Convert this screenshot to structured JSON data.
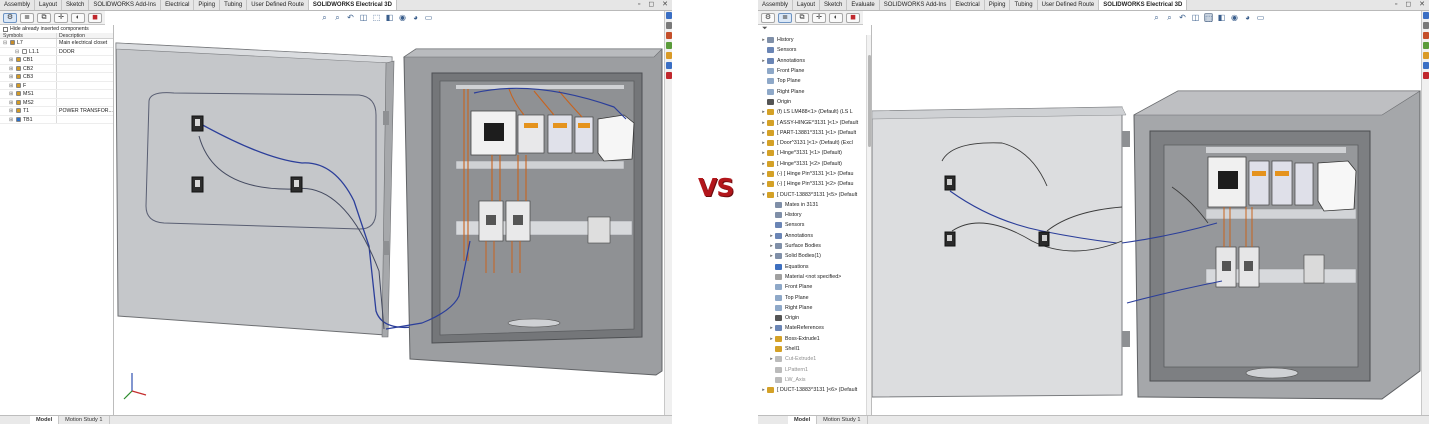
{
  "comparison": {
    "separator_label": "VS"
  },
  "colors": {
    "vs_red": "#b2161b",
    "enclosure_grey": "#9a9a9a",
    "wire_blue": "#2b3e9a",
    "wire_orange": "#c8631e",
    "accent_blue": "#3a5e8c"
  },
  "left": {
    "command_tabs": [
      "Assembly",
      "Layout",
      "Sketch",
      "SOLIDWORKS Add-Ins",
      "Electrical",
      "Piping",
      "Tubing",
      "User Defined Route",
      "SOLIDWORKS Electrical 3D"
    ],
    "active_tab_index": 8,
    "panel": {
      "hide_label": "Hide already inserted components",
      "columns": [
        "Symbols",
        "Description"
      ],
      "rows": [
        {
          "symbol": "L7",
          "description": "Main electrical closet",
          "expanded": true,
          "color": "#c68c2a"
        },
        {
          "symbol": "L1.1",
          "description": "DOOR",
          "expanded": true,
          "color": "#ffffff"
        },
        {
          "symbol": "CB1",
          "description": "",
          "expanded": false,
          "color": "#d29a25"
        },
        {
          "symbol": "CB2",
          "description": "",
          "expanded": false,
          "color": "#d29a25"
        },
        {
          "symbol": "CB3",
          "description": "",
          "expanded": false,
          "color": "#d29a25"
        },
        {
          "symbol": "F",
          "description": "",
          "expanded": false,
          "color": "#d29a25"
        },
        {
          "symbol": "MS1",
          "description": "",
          "expanded": false,
          "color": "#d29a25"
        },
        {
          "symbol": "MS2",
          "description": "",
          "expanded": false,
          "color": "#d29a25"
        },
        {
          "symbol": "T1",
          "description": "POWER TRANSFOR...",
          "expanded": false,
          "color": "#d29a25"
        },
        {
          "symbol": "TB1",
          "description": "",
          "expanded": false,
          "color": "#2c6fc7"
        }
      ]
    },
    "bottom_tabs": [
      "Model",
      "Motion Study 1"
    ],
    "active_bottom_index": 0
  },
  "right": {
    "command_tabs": [
      "Assembly",
      "Layout",
      "Sketch",
      "Evaluate",
      "SOLIDWORKS Add-Ins",
      "Electrical",
      "Piping",
      "Tubing",
      "User Defined Route",
      "SOLIDWORKS Electrical 3D"
    ],
    "active_tab_index": 9,
    "tree": [
      {
        "label": "History",
        "expander": "▸",
        "icon": "#7f8fa8",
        "state": "normal"
      },
      {
        "label": "Sensors",
        "expander": "",
        "icon": "#6a85b5",
        "state": "normal"
      },
      {
        "label": "Annotations",
        "expander": "▸",
        "icon": "#6a85b5",
        "state": "normal"
      },
      {
        "label": "Front Plane",
        "expander": "",
        "icon": "#8ea8c8",
        "state": "normal"
      },
      {
        "label": "Top Plane",
        "expander": "",
        "icon": "#8ea8c8",
        "state": "normal"
      },
      {
        "label": "Right Plane",
        "expander": "",
        "icon": "#8ea8c8",
        "state": "normal"
      },
      {
        "label": "Origin",
        "expander": "",
        "icon": "#555555",
        "state": "normal"
      },
      {
        "label": "(f) LS LM488<1> (Default) (LS L",
        "expander": "▸",
        "icon": "#d4a127",
        "state": "normal"
      },
      {
        "label": "[ ASSY-HINGE^3131 ]<1> (Default",
        "expander": "▸",
        "icon": "#d4a127",
        "state": "normal"
      },
      {
        "label": "[ PART-13881^3131 ]<1> (Default",
        "expander": "▸",
        "icon": "#d4a127",
        "state": "normal"
      },
      {
        "label": "[ Door^3131 ]<1> (Default) (Excl",
        "expander": "▸",
        "icon": "#d4a127",
        "state": "normal"
      },
      {
        "label": "[ Hinge^3131 ]<1> (Default)",
        "expander": "▸",
        "icon": "#d4a127",
        "state": "normal"
      },
      {
        "label": "[ Hinge^3131 ]<2> (Default)",
        "expander": "▸",
        "icon": "#d4a127",
        "state": "normal"
      },
      {
        "label": "(-) [ Hinge Pin^3131 ]<1> (Defau",
        "expander": "▸",
        "icon": "#d4a127",
        "state": "normal"
      },
      {
        "label": "(-) [ Hinge Pin^3131 ]<2> (Defau",
        "expander": "▸",
        "icon": "#d4a127",
        "state": "normal"
      },
      {
        "label": "[ DUCT-13883^3131 ]<5> (Default",
        "expander": "▾",
        "icon": "#d4a127",
        "state": "normal"
      },
      {
        "label": "Mates in 3131",
        "expander": "",
        "icon": "#7f8fa8",
        "state": "sub"
      },
      {
        "label": "History",
        "expander": "",
        "icon": "#7f8fa8",
        "state": "sub"
      },
      {
        "label": "Sensors",
        "expander": "",
        "icon": "#6a85b5",
        "state": "sub"
      },
      {
        "label": "Annotations",
        "expander": "▸",
        "icon": "#6a85b5",
        "state": "sub"
      },
      {
        "label": "Surface Bodies",
        "expander": "▸",
        "icon": "#7f8fa8",
        "state": "sub"
      },
      {
        "label": "Solid Bodies(1)",
        "expander": "▸",
        "icon": "#7f8fa8",
        "state": "sub"
      },
      {
        "label": "Equations",
        "expander": "",
        "icon": "#3d6fbf",
        "state": "sub"
      },
      {
        "label": "Material <not specified>",
        "expander": "",
        "icon": "#a0a0a0",
        "state": "sub"
      },
      {
        "label": "Front Plane",
        "expander": "",
        "icon": "#8ea8c8",
        "state": "sub"
      },
      {
        "label": "Top Plane",
        "expander": "",
        "icon": "#8ea8c8",
        "state": "sub"
      },
      {
        "label": "Right Plane",
        "expander": "",
        "icon": "#8ea8c8",
        "state": "sub"
      },
      {
        "label": "Origin",
        "expander": "",
        "icon": "#555555",
        "state": "sub"
      },
      {
        "label": "MateReferences",
        "expander": "▸",
        "icon": "#6a85b5",
        "state": "sub"
      },
      {
        "label": "Boss-Extrude1",
        "expander": "▸",
        "icon": "#d4a127",
        "state": "sub"
      },
      {
        "label": "Shell1",
        "expander": "",
        "icon": "#d4a127",
        "state": "sub"
      },
      {
        "label": "Cut-Extrude1",
        "expander": "▸",
        "icon": "#bbbbbb",
        "state": "grey"
      },
      {
        "label": "LPattern1",
        "expander": "",
        "icon": "#bbbbbb",
        "state": "grey"
      },
      {
        "label": "LW_Axis",
        "expander": "",
        "icon": "#bbbbbb",
        "state": "grey"
      },
      {
        "label": "[ DUCT-13883^3131 ]<6> (Default",
        "expander": "▸",
        "icon": "#d4a127",
        "state": "normal"
      }
    ],
    "bottom_tabs": [
      "Model",
      "Motion Study 1"
    ],
    "active_bottom_index": 0
  }
}
